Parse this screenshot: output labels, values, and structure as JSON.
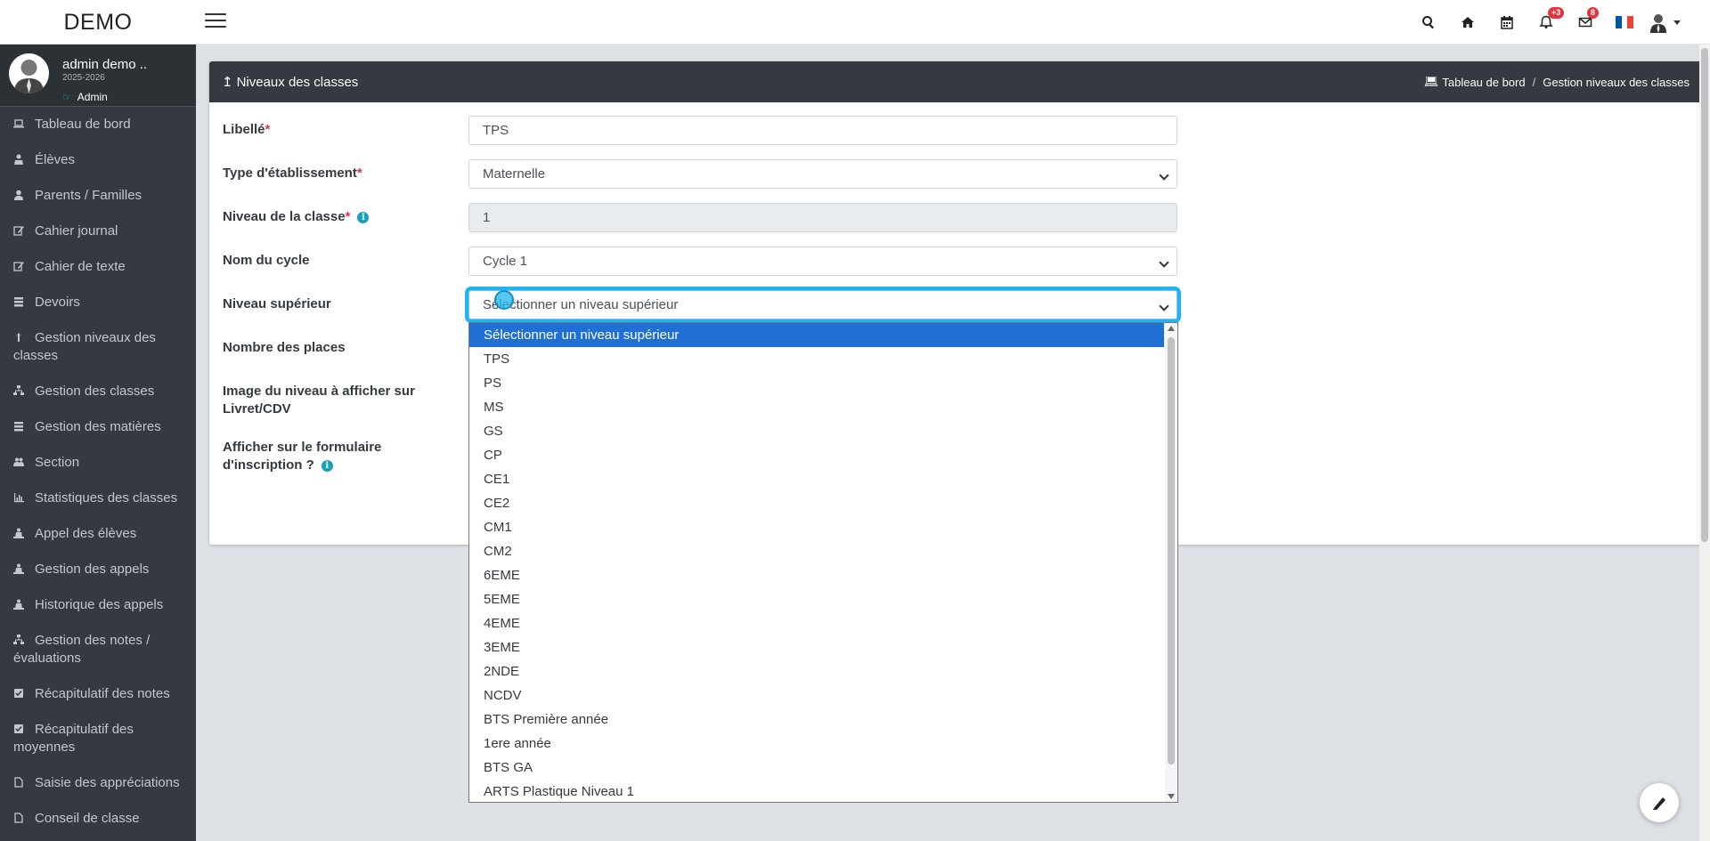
{
  "app": {
    "brand": "DEMO"
  },
  "topbar": {
    "notifications_count": "+3",
    "messages_count": "8",
    "icons": [
      "search-icon",
      "home-icon",
      "calendar-icon",
      "bell-icon",
      "envelope-icon",
      "flag-fr-icon",
      "user-icon"
    ],
    "flag_colors": [
      "#0055a4",
      "#ffffff",
      "#ef4135"
    ]
  },
  "profile": {
    "name": "admin demo ..",
    "year": "2025-2026",
    "role": "Admin"
  },
  "sidebar": {
    "items": [
      {
        "label": "Tableau de bord",
        "icon": "laptop-icon"
      },
      {
        "label": "Élèves",
        "icon": "student-icon"
      },
      {
        "label": "Parents / Familles",
        "icon": "user-icon"
      },
      {
        "label": "Cahier journal",
        "icon": "edit-icon"
      },
      {
        "label": "Cahier de texte",
        "icon": "edit-icon"
      },
      {
        "label": "Devoirs",
        "icon": "list-icon"
      },
      {
        "label": "Gestion niveaux des classes",
        "icon": "level-up-icon"
      },
      {
        "label": "Gestion des classes",
        "icon": "sitemap-icon"
      },
      {
        "label": "Gestion des matières",
        "icon": "list-icon"
      },
      {
        "label": "Section",
        "icon": "users-icon"
      },
      {
        "label": "Statistiques des classes",
        "icon": "bar-chart-icon"
      },
      {
        "label": "Appel des élèves",
        "icon": "attendance-icon"
      },
      {
        "label": "Gestion des appels",
        "icon": "attendance-icon"
      },
      {
        "label": "Historique des appels",
        "icon": "attendance-icon"
      },
      {
        "label": "Gestion des notes / évaluations",
        "icon": "sitemap-icon"
      },
      {
        "label": "Récapitulatif des notes",
        "icon": "checkbox-icon"
      },
      {
        "label": "Récapitulatif des moyennes",
        "icon": "checkbox-icon"
      },
      {
        "label": "Saisie des appréciations",
        "icon": "file-icon"
      },
      {
        "label": "Conseil de classe",
        "icon": "file-icon"
      }
    ]
  },
  "card": {
    "title": "Niveaux des classes",
    "breadcrumb": {
      "home": "Tableau de bord",
      "current": "Gestion niveaux des classes"
    }
  },
  "form": {
    "libelle": {
      "label": "Libellé",
      "value": "TPS"
    },
    "type_etab": {
      "label": "Type d'établissement",
      "value": "Maternelle"
    },
    "niveau": {
      "label": "Niveau de la classe",
      "value": "1"
    },
    "cycle": {
      "label": "Nom du cycle",
      "value": "Cycle 1"
    },
    "niveau_sup": {
      "label": "Niveau supérieur",
      "value": "Sélectionner un niveau supérieur"
    },
    "places": {
      "label": "Nombre des places"
    },
    "image": {
      "label_line1": "Image du niveau à afficher sur",
      "label_line2": "Livret/CDV"
    },
    "afficher": {
      "label_line1": "Afficher sur le formulaire",
      "label_line2": "d'inscription ?"
    },
    "required_mark": "*"
  },
  "dropdown": {
    "options": [
      "Sélectionner un niveau supérieur",
      "TPS",
      "PS",
      "MS",
      "GS",
      "CP",
      "CE1",
      "CE2",
      "CM1",
      "CM2",
      "6EME",
      "5EME",
      "4EME",
      "3EME",
      "2NDE",
      "NCDV",
      "BTS Première année",
      "1ere année",
      "BTS GA",
      "ARTS Plastique Niveau 1"
    ],
    "selected_index": 0
  }
}
